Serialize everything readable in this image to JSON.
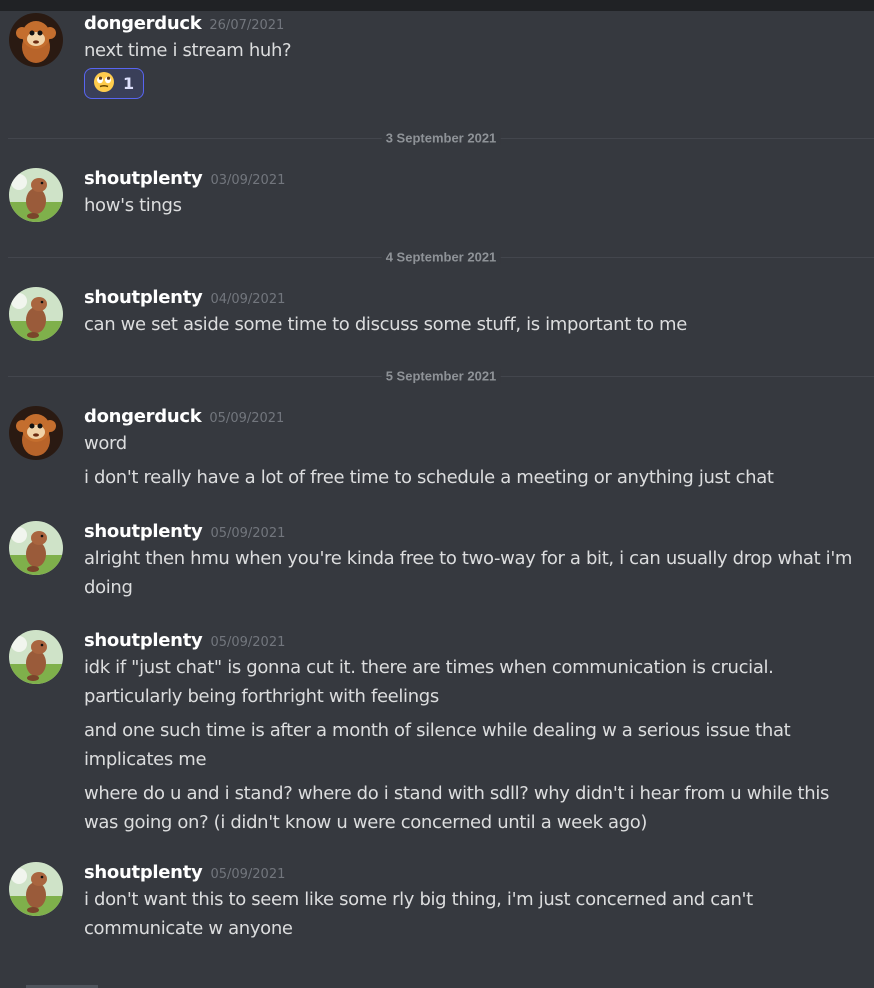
{
  "colors": {
    "background": "#36393f",
    "username": "#ffffff",
    "timestamp": "#72767d",
    "text": "#dcddde",
    "reaction_border": "#5865f2"
  },
  "messages": [
    {
      "username": "dongerduck",
      "avatar": "monkey-avatar",
      "timestamp": "26/07/2021",
      "lines": [
        "next time i stream huh?"
      ],
      "reaction": {
        "emoji": "face-with-rolling-eyes",
        "count": "1"
      }
    },
    {
      "divider": "3 September 2021",
      "username": "shoutplenty",
      "avatar": "dinosaur-avatar",
      "timestamp": "03/09/2021",
      "lines": [
        "how's tings"
      ]
    },
    {
      "divider": "4 September 2021",
      "username": "shoutplenty",
      "avatar": "dinosaur-avatar",
      "timestamp": "04/09/2021",
      "lines": [
        "can we set aside some time to discuss some stuff, is important to me"
      ]
    },
    {
      "divider": "5 September 2021",
      "username": "dongerduck",
      "avatar": "monkey-avatar",
      "timestamp": "05/09/2021",
      "lines": [
        "word",
        "i don't really have a lot of free time to schedule a meeting or anything just chat"
      ]
    },
    {
      "username": "shoutplenty",
      "avatar": "dinosaur-avatar",
      "timestamp": "05/09/2021",
      "lines": [
        "alright then hmu when you're kinda free to two-way for a bit, i can usually drop what i'm doing"
      ]
    },
    {
      "username": "shoutplenty",
      "avatar": "dinosaur-avatar",
      "timestamp": "05/09/2021",
      "lines": [
        "idk if \"just chat\" is gonna cut it. there are times when communication is crucial. particularly being forthright with feelings",
        "and one such time is after a month of silence while dealing w a serious issue that implicates me",
        "where do u and i stand? where do i stand with sdll? why didn't i hear from u while this was going on? (i didn't know u were concerned until a week ago)"
      ]
    },
    {
      "username": "shoutplenty",
      "avatar": "dinosaur-avatar",
      "timestamp": "05/09/2021",
      "lines": [
        "i don't want this to seem like some rly big thing, i'm just concerned and can't communicate w anyone"
      ]
    }
  ]
}
